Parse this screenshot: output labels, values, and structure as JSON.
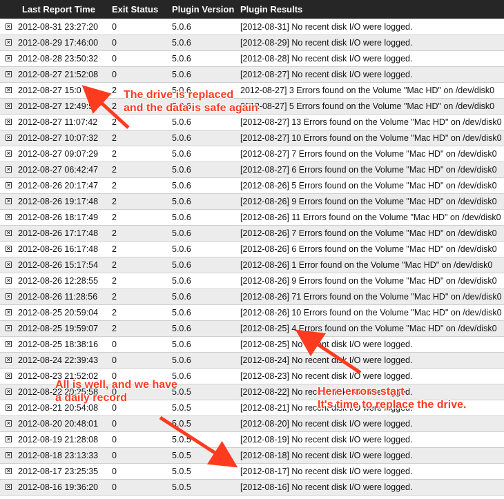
{
  "columns": {
    "time": "Last Report Time",
    "exit": "Exit Status",
    "version": "Plugin Version",
    "results": "Plugin Results"
  },
  "rows": [
    {
      "time": "2012-08-31 23:27:20",
      "exit": "0",
      "version": "5.0.6",
      "result": "[2012-08-31] No recent disk I/O were logged."
    },
    {
      "time": "2012-08-29 17:46:00",
      "exit": "0",
      "version": "5.0.6",
      "result": "[2012-08-29] No recent disk I/O were logged."
    },
    {
      "time": "2012-08-28 23:50:32",
      "exit": "0",
      "version": "5.0.6",
      "result": "[2012-08-28] No recent disk I/O were logged."
    },
    {
      "time": "2012-08-27 21:52:08",
      "exit": "0",
      "version": "5.0.6",
      "result": "[2012-08-27] No recent disk I/O were logged."
    },
    {
      "time": "2012-08-27 15:0",
      "exit": "2",
      "version": "5.0.6",
      "result": "2012-08-27] 3 Errors found on the Volume \"Mac HD\" on /dev/disk0"
    },
    {
      "time": "2012-08-27 12:49:56",
      "exit": "2",
      "version": "5.0.6",
      "result": "2012-08-27] 5 Errors found on the Volume \"Mac HD\" on /dev/disk0"
    },
    {
      "time": "2012-08-27 11:07:42",
      "exit": "2",
      "version": "5.0.6",
      "result": "[2012-08-27] 13 Errors found on the Volume \"Mac HD\" on /dev/disk0"
    },
    {
      "time": "2012-08-27 10:07:32",
      "exit": "2",
      "version": "5.0.6",
      "result": "[2012-08-27] 10 Errors found on the Volume \"Mac HD\" on /dev/disk0"
    },
    {
      "time": "2012-08-27 09:07:29",
      "exit": "2",
      "version": "5.0.6",
      "result": "[2012-08-27] 7 Errors found on the Volume \"Mac HD\" on /dev/disk0"
    },
    {
      "time": "2012-08-27 06:42:47",
      "exit": "2",
      "version": "5.0.6",
      "result": "[2012-08-27] 6 Errors found on the Volume \"Mac HD\" on /dev/disk0"
    },
    {
      "time": "2012-08-26 20:17:47",
      "exit": "2",
      "version": "5.0.6",
      "result": "[2012-08-26] 5 Errors found on the Volume \"Mac HD\" on /dev/disk0"
    },
    {
      "time": "2012-08-26 19:17:48",
      "exit": "2",
      "version": "5.0.6",
      "result": "[2012-08-26] 9 Errors found on the Volume \"Mac HD\" on /dev/disk0"
    },
    {
      "time": "2012-08-26 18:17:49",
      "exit": "2",
      "version": "5.0.6",
      "result": "[2012-08-26] 11 Errors found on the Volume \"Mac HD\" on /dev/disk0"
    },
    {
      "time": "2012-08-26 17:17:48",
      "exit": "2",
      "version": "5.0.6",
      "result": "[2012-08-26] 7 Errors found on the Volume \"Mac HD\" on /dev/disk0"
    },
    {
      "time": "2012-08-26 16:17:48",
      "exit": "2",
      "version": "5.0.6",
      "result": "[2012-08-26] 6 Errors found on the Volume \"Mac HD\" on /dev/disk0"
    },
    {
      "time": "2012-08-26 15:17:54",
      "exit": "2",
      "version": "5.0.6",
      "result": "[2012-08-26] 1 Error found on the Volume \"Mac HD\" on /dev/disk0"
    },
    {
      "time": "2012-08-26 12:28:55",
      "exit": "2",
      "version": "5.0.6",
      "result": "[2012-08-26] 9 Errors found on the Volume \"Mac HD\" on /dev/disk0"
    },
    {
      "time": "2012-08-26 11:28:56",
      "exit": "2",
      "version": "5.0.6",
      "result": "[2012-08-26] 71 Errors found on the Volume \"Mac HD\" on /dev/disk0"
    },
    {
      "time": "2012-08-25 20:59:04",
      "exit": "2",
      "version": "5.0.6",
      "result": "[2012-08-26] 10 Errors found on the Volume \"Mac HD\" on /dev/disk0"
    },
    {
      "time": "2012-08-25 19:59:07",
      "exit": "2",
      "version": "5.0.6",
      "result": "[2012-08-25] 4 Errors found on the Volume \"Mac HD\" on /dev/disk0"
    },
    {
      "time": "2012-08-25 18:38:16",
      "exit": "0",
      "version": "5.0.6",
      "result": "[2012-08-25] No recent disk I/O were logged."
    },
    {
      "time": "2012-08-24 22:39:43",
      "exit": "0",
      "version": "5.0.6",
      "result": "[2012-08-24] No recent disk I/O were logged."
    },
    {
      "time": "2012-08-23 21:52:02",
      "exit": "0",
      "version": "5.0.6",
      "result": "[2012-08-23] No recent disk I/O were logged."
    },
    {
      "time": "2012-08-22 20:25:58",
      "exit": "0",
      "version": "5.0.5",
      "result": "[2012-08-22] No recent disk I/O were logged."
    },
    {
      "time": "2012-08-21 20:54:08",
      "exit": "0",
      "version": "5.0.5",
      "result": "[2012-08-21] No recent disk I/O were logged."
    },
    {
      "time": "2012-08-20 20:48:01",
      "exit": "0",
      "version": "5.0.5",
      "result": "[2012-08-20] No recent disk I/O were logged."
    },
    {
      "time": "2012-08-19 21:28:08",
      "exit": "0",
      "version": "5.0.5",
      "result": "[2012-08-19] No recent disk I/O were logged."
    },
    {
      "time": "2012-08-18 23:13:33",
      "exit": "0",
      "version": "5.0.5",
      "result": "[2012-08-18] No recent disk I/O were logged."
    },
    {
      "time": "2012-08-17 23:25:35",
      "exit": "0",
      "version": "5.0.5",
      "result": "[2012-08-17] No recent disk I/O were logged."
    },
    {
      "time": "2012-08-16 19:36:20",
      "exit": "0",
      "version": "5.0.5",
      "result": "[2012-08-16] No recent disk I/O were logged."
    }
  ],
  "annotations": {
    "replaced": [
      "The drive is replaced",
      "and the data is safe again"
    ],
    "daily": [
      "All is well, and we have",
      "a daily record"
    ],
    "errors": [
      "Here errors start",
      "It's time to replace the drive."
    ]
  },
  "colors": {
    "header_bg": "#262626",
    "annotation": "#ff3b1f",
    "alt_row": "#ececec"
  }
}
